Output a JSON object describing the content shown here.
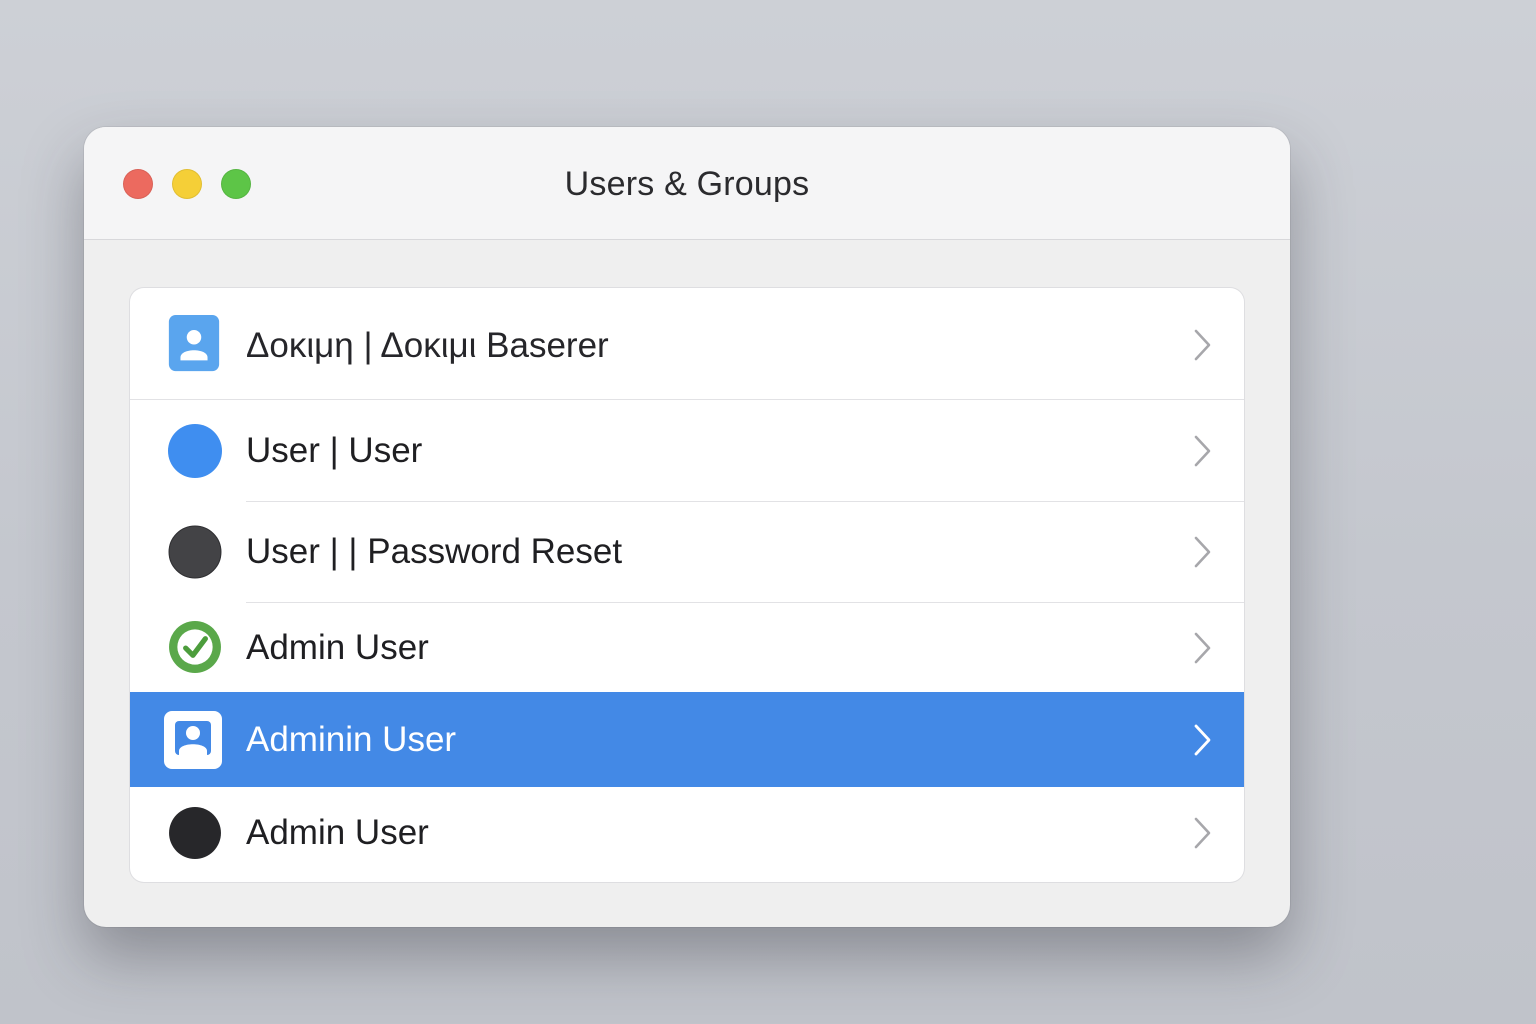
{
  "window": {
    "title": "Users & Groups"
  },
  "colors": {
    "close": "#ec6a5f",
    "minimize": "#f5cf37",
    "zoom": "#5dc547",
    "selection": "#4389e6"
  },
  "users": [
    {
      "label": "Δοκιμη | Δοκιμι Baserer",
      "icon": "user-card-icon",
      "selected": false
    },
    {
      "label": "User | User",
      "icon": "blue-circle-avatar",
      "selected": false
    },
    {
      "label": "User | | Password Reset",
      "icon": "dark-gray-circle-avatar",
      "selected": false
    },
    {
      "label": "Admin User",
      "icon": "green-check-icon",
      "selected": false
    },
    {
      "label": "Adminin User",
      "icon": "user-card-icon",
      "selected": true
    },
    {
      "label": "Admin User",
      "icon": "black-circle-avatar",
      "selected": false
    }
  ]
}
